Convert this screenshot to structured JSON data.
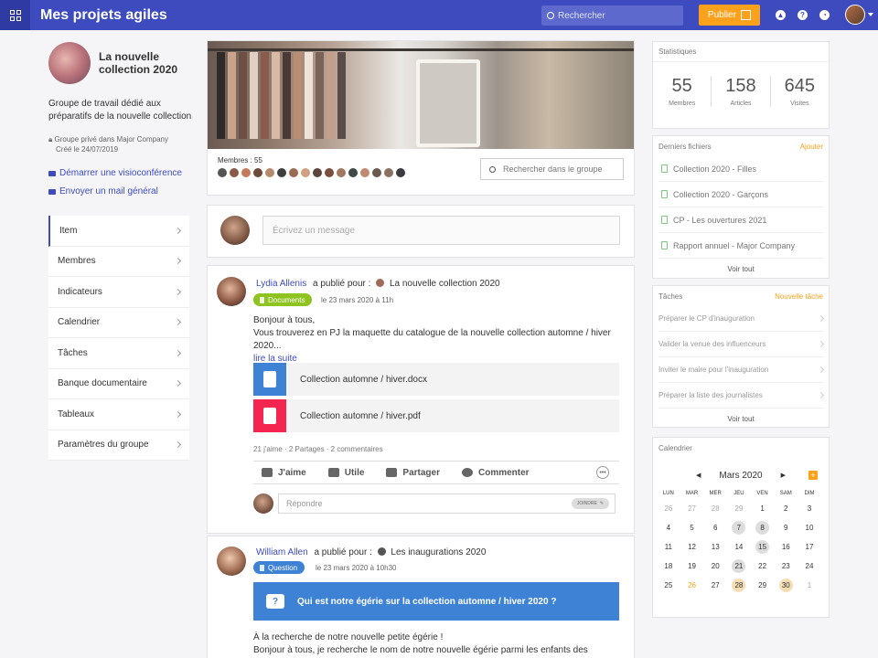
{
  "topbar": {
    "title": "Mes projets agiles",
    "search_placeholder": "Rechercher",
    "publish_label": "Publier",
    "icons": [
      "rocket-icon",
      "help-icon",
      "clock-icon"
    ]
  },
  "group": {
    "title": "La nouvelle collection 2020",
    "description": "Groupe de travail dédié aux préparatifs de la nouvelle collection",
    "privacy": "Groupe privé dans Major Company",
    "created": "Créé le 24/07/2019",
    "video_link": "Démarrer une visioconférence",
    "mail_link": "Envoyer un mail général"
  },
  "nav": {
    "items": [
      {
        "label": "Item"
      },
      {
        "label": "Membres"
      },
      {
        "label": "Indicateurs"
      },
      {
        "label": "Calendrier"
      },
      {
        "label": "Tâches"
      },
      {
        "label": "Banque documentaire"
      },
      {
        "label": "Tableaux"
      },
      {
        "label": "Paramètres du groupe"
      }
    ]
  },
  "members": {
    "label": "Membres : 55",
    "avatar_colors": [
      "#555555",
      "#8a5a44",
      "#c47a5a",
      "#6e4a3a",
      "#b58a6e",
      "#3f3f3f",
      "#9a6b55",
      "#d0a080",
      "#5b463c",
      "#7c5040",
      "#a07860",
      "#404848",
      "#c08a70",
      "#6a5a50",
      "#8a7060",
      "#3a3a40"
    ],
    "search_placeholder": "Rechercher dans le groupe"
  },
  "composer": {
    "placeholder": "Écrivez un message"
  },
  "posts": [
    {
      "author": "Lydia Allenis",
      "published_for": "a publié pour :",
      "target": "La nouvelle collection 2020",
      "badge": "Documents",
      "badge_color": "#8fc31f",
      "date": "le 23 mars 2020 à 11h",
      "line1": "Bonjour à tous,",
      "line2": "Vous trouverez en PJ la maquette du catalogue de la nouvelle collection automne / hiver 2020...",
      "read_more": "lire la suite",
      "files": [
        {
          "name": "Collection automne / hiver.docx",
          "color": "#3e82d6"
        },
        {
          "name": "Collection automne / hiver.pdf",
          "color": "#f4254f"
        }
      ],
      "stats": "21 j'aime · 2 Partages · 2 commentaires",
      "actions": [
        "J'aime",
        "Utile",
        "Partager",
        "Commenter"
      ],
      "reply_placeholder": "Répondre",
      "join_label": "JOINDRE"
    },
    {
      "author": "William Allen",
      "published_for": "a publié pour :",
      "target": "Les inaugurations 2020",
      "badge": "Question",
      "badge_color": "#3e82d6",
      "date": "le 23 mars 2020 à 10h30",
      "question": "Qui est notre égérie sur la collection automne / hiver 2020 ?",
      "line1": "À la recherche de notre nouvelle petite égérie !",
      "line2": "Bonjour à tous, je recherche le nom de notre nouvelle égérie parmi les enfants des collaborateurs"
    }
  ],
  "statistics": {
    "title": "Statistiques",
    "items": [
      {
        "value": "55",
        "label": "Membres"
      },
      {
        "value": "158",
        "label": "Articles"
      },
      {
        "value": "645",
        "label": "Visites"
      }
    ]
  },
  "files": {
    "title": "Derniers fichiers",
    "add": "Ajouter",
    "items": [
      "Collection 2020 - Filles",
      "Collection 2020 - Garçons",
      "CP - Les ouvertures 2021",
      "Rapport annuel - Major Company"
    ],
    "see_all": "Voir tout"
  },
  "tasks": {
    "title": "Tâches",
    "add": "Nouvelle tâche",
    "items": [
      "Préparer le CP d'inauguration",
      "Valider la venue des influenceurs",
      "Inviter le maire pour l'inauguration",
      "Préparer la liste des journalistes"
    ],
    "see_all": "Voir tout"
  },
  "calendar": {
    "title": "Calendrier",
    "month": "Mars 2020",
    "day_headers": [
      "LUN",
      "MAR",
      "MER",
      "JEU",
      "VEN",
      "SAM",
      "DIM"
    ],
    "days": [
      {
        "d": "26",
        "s": "muted"
      },
      {
        "d": "27",
        "s": "muted"
      },
      {
        "d": "28",
        "s": "muted"
      },
      {
        "d": "29",
        "s": "muted"
      },
      {
        "d": "1",
        "s": ""
      },
      {
        "d": "2",
        "s": ""
      },
      {
        "d": "3",
        "s": ""
      },
      {
        "d": "4",
        "s": ""
      },
      {
        "d": "5",
        "s": ""
      },
      {
        "d": "6",
        "s": ""
      },
      {
        "d": "7",
        "s": "grey"
      },
      {
        "d": "8",
        "s": "grey"
      },
      {
        "d": "9",
        "s": ""
      },
      {
        "d": "10",
        "s": ""
      },
      {
        "d": "11",
        "s": ""
      },
      {
        "d": "12",
        "s": ""
      },
      {
        "d": "13",
        "s": ""
      },
      {
        "d": "14",
        "s": ""
      },
      {
        "d": "15",
        "s": "grey"
      },
      {
        "d": "16",
        "s": ""
      },
      {
        "d": "17",
        "s": ""
      },
      {
        "d": "18",
        "s": ""
      },
      {
        "d": "19",
        "s": ""
      },
      {
        "d": "20",
        "s": ""
      },
      {
        "d": "21",
        "s": "grey"
      },
      {
        "d": "22",
        "s": ""
      },
      {
        "d": "23",
        "s": ""
      },
      {
        "d": "24",
        "s": ""
      },
      {
        "d": "25",
        "s": ""
      },
      {
        "d": "26",
        "s": "ortext"
      },
      {
        "d": "27",
        "s": ""
      },
      {
        "d": "28",
        "s": "orange"
      },
      {
        "d": "29",
        "s": ""
      },
      {
        "d": "30",
        "s": "orange"
      },
      {
        "d": "1",
        "s": "muted"
      }
    ]
  }
}
